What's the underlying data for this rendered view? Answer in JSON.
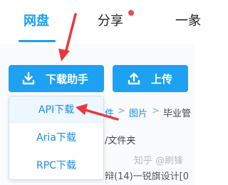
{
  "nav": {
    "tabs": [
      "网盘",
      "分享",
      "一彖"
    ]
  },
  "toolbar": {
    "download_label": "下载助手",
    "upload_label": "上传"
  },
  "dropdown": {
    "items": [
      "API下载",
      "Aria下载",
      "RPC下载"
    ]
  },
  "breadcrumb": {
    "items": [
      "件",
      "图片",
      "毕业管"
    ]
  },
  "folder_label": "/文件夹",
  "file_row_text": "辩(14)一锐旗设计[0",
  "watermark": "知乎 @刷锋",
  "colors": {
    "accent": "#1da1f2",
    "annotation_arrow": "#e8383d",
    "notification_dot": "#f04b4b"
  }
}
